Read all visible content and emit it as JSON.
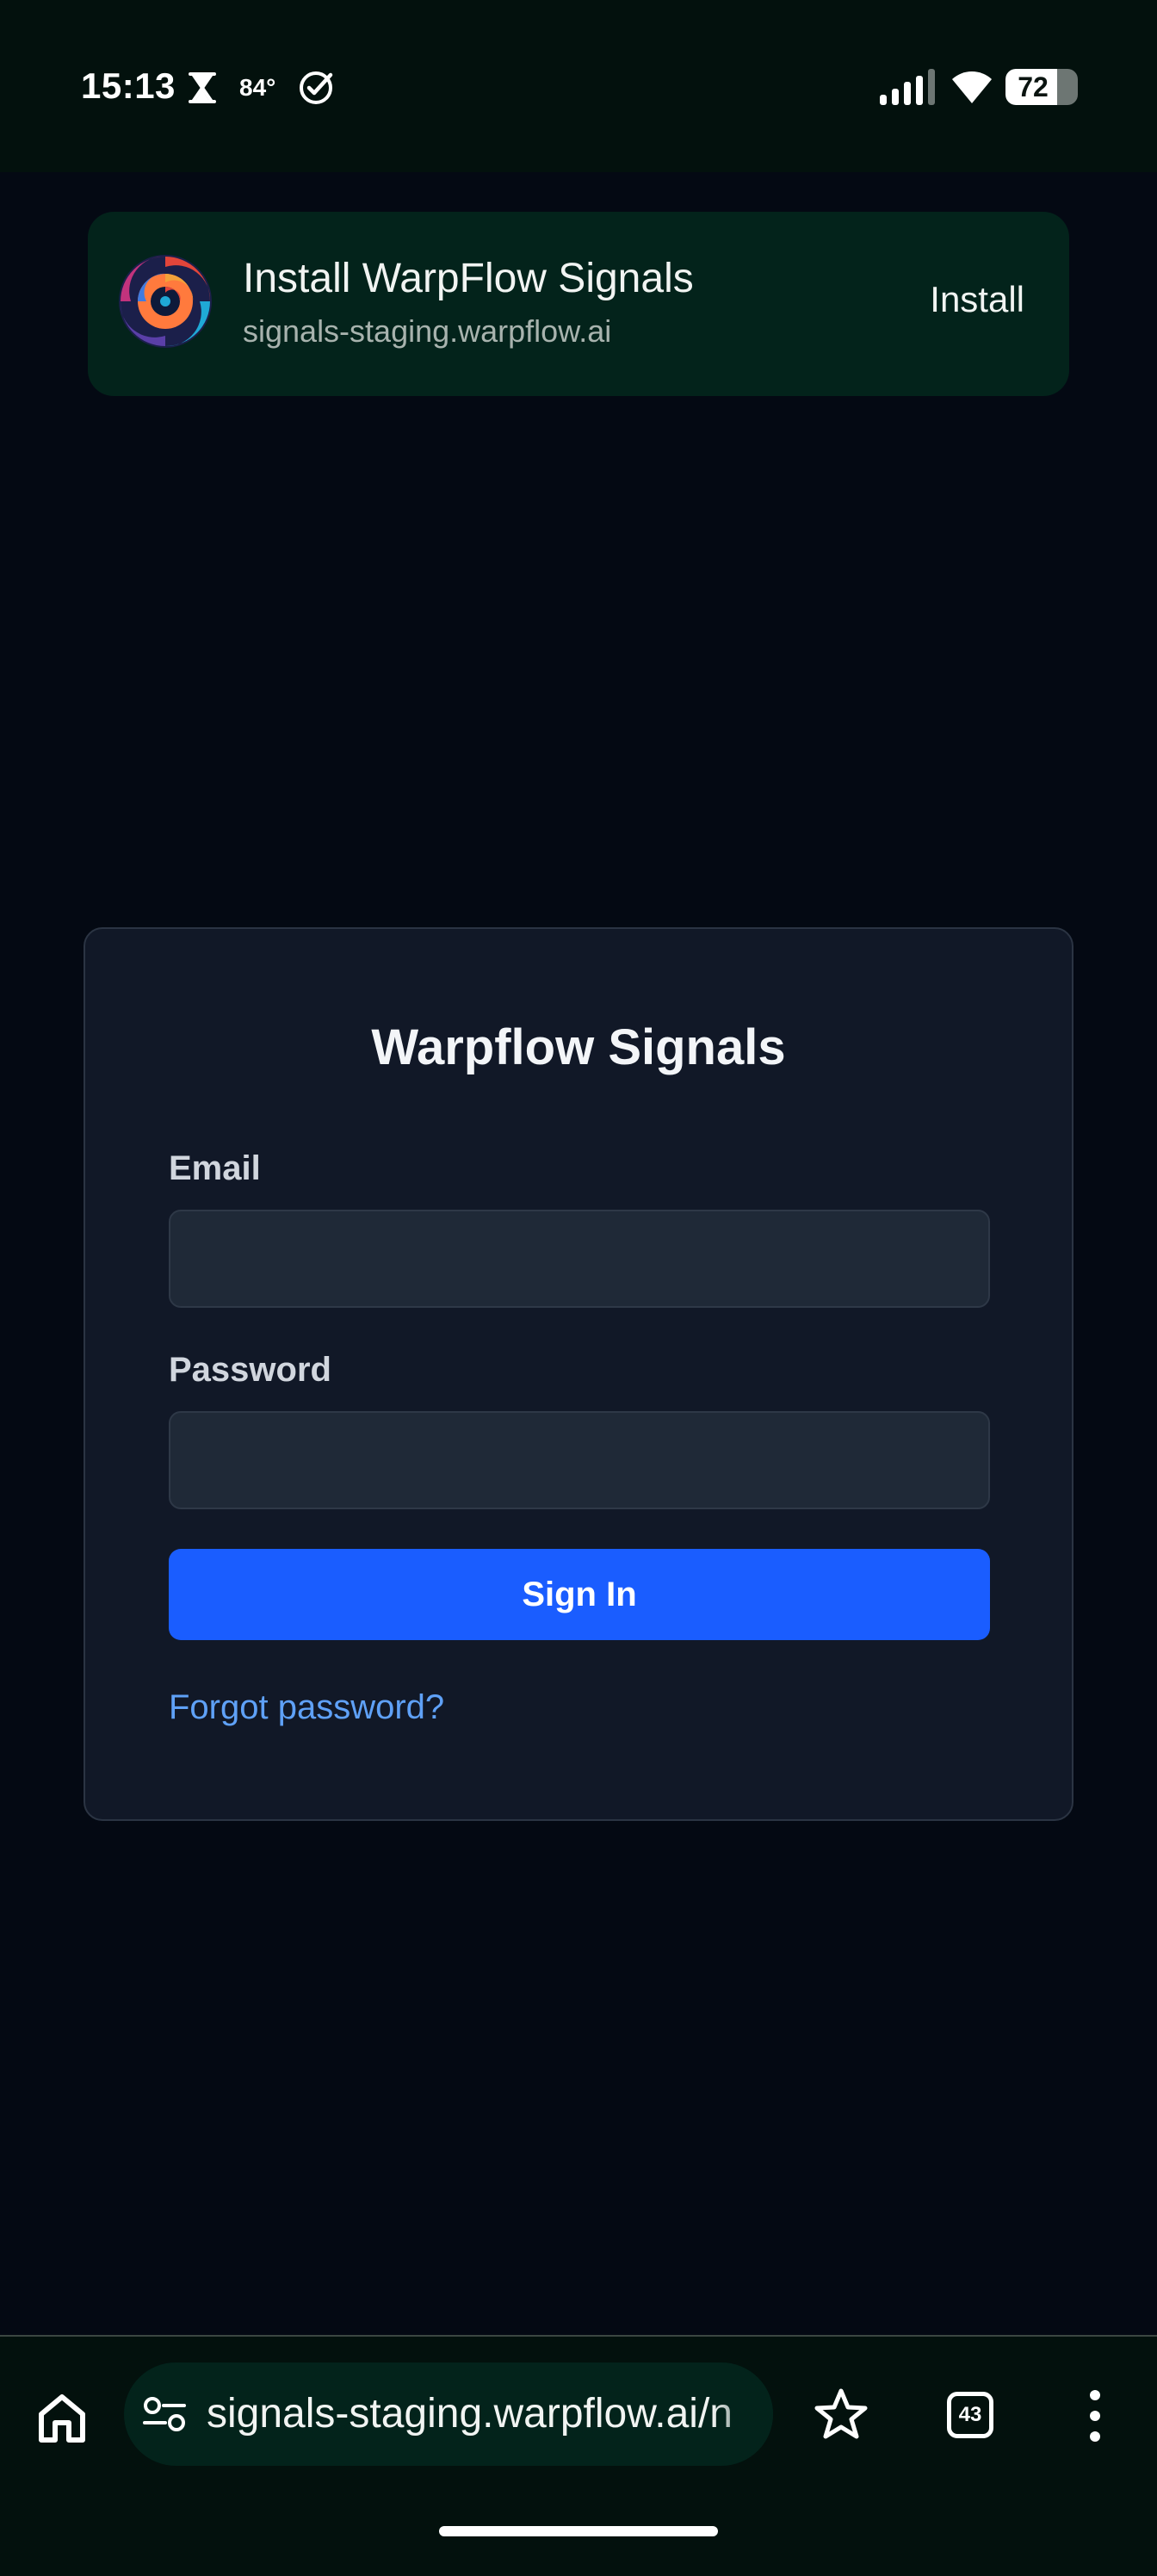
{
  "status_bar": {
    "time": "15:13",
    "temperature": "84°",
    "battery_level": "72",
    "battery_fraction": 0.72,
    "icons": [
      "hourglass-icon",
      "check-circle-icon",
      "signal-icon",
      "wifi-icon",
      "battery-icon"
    ]
  },
  "install_banner": {
    "title": "Install WarpFlow Signals",
    "url": "signals-staging.warpflow.ai",
    "install_label": "Install"
  },
  "login": {
    "title": "Warpflow Signals",
    "email_label": "Email",
    "email_value": "",
    "password_label": "Password",
    "password_value": "",
    "sign_in_label": "Sign In",
    "forgot_label": "Forgot password?"
  },
  "browser": {
    "url": "signals-staging.warpflow.ai/n",
    "tab_count": "43"
  },
  "colors": {
    "page_background": "#040913",
    "card_background": "#111827",
    "input_background": "#1f2937",
    "primary_button": "#1a5dff",
    "link": "#5fa1f7",
    "banner_background": "#03231b"
  }
}
